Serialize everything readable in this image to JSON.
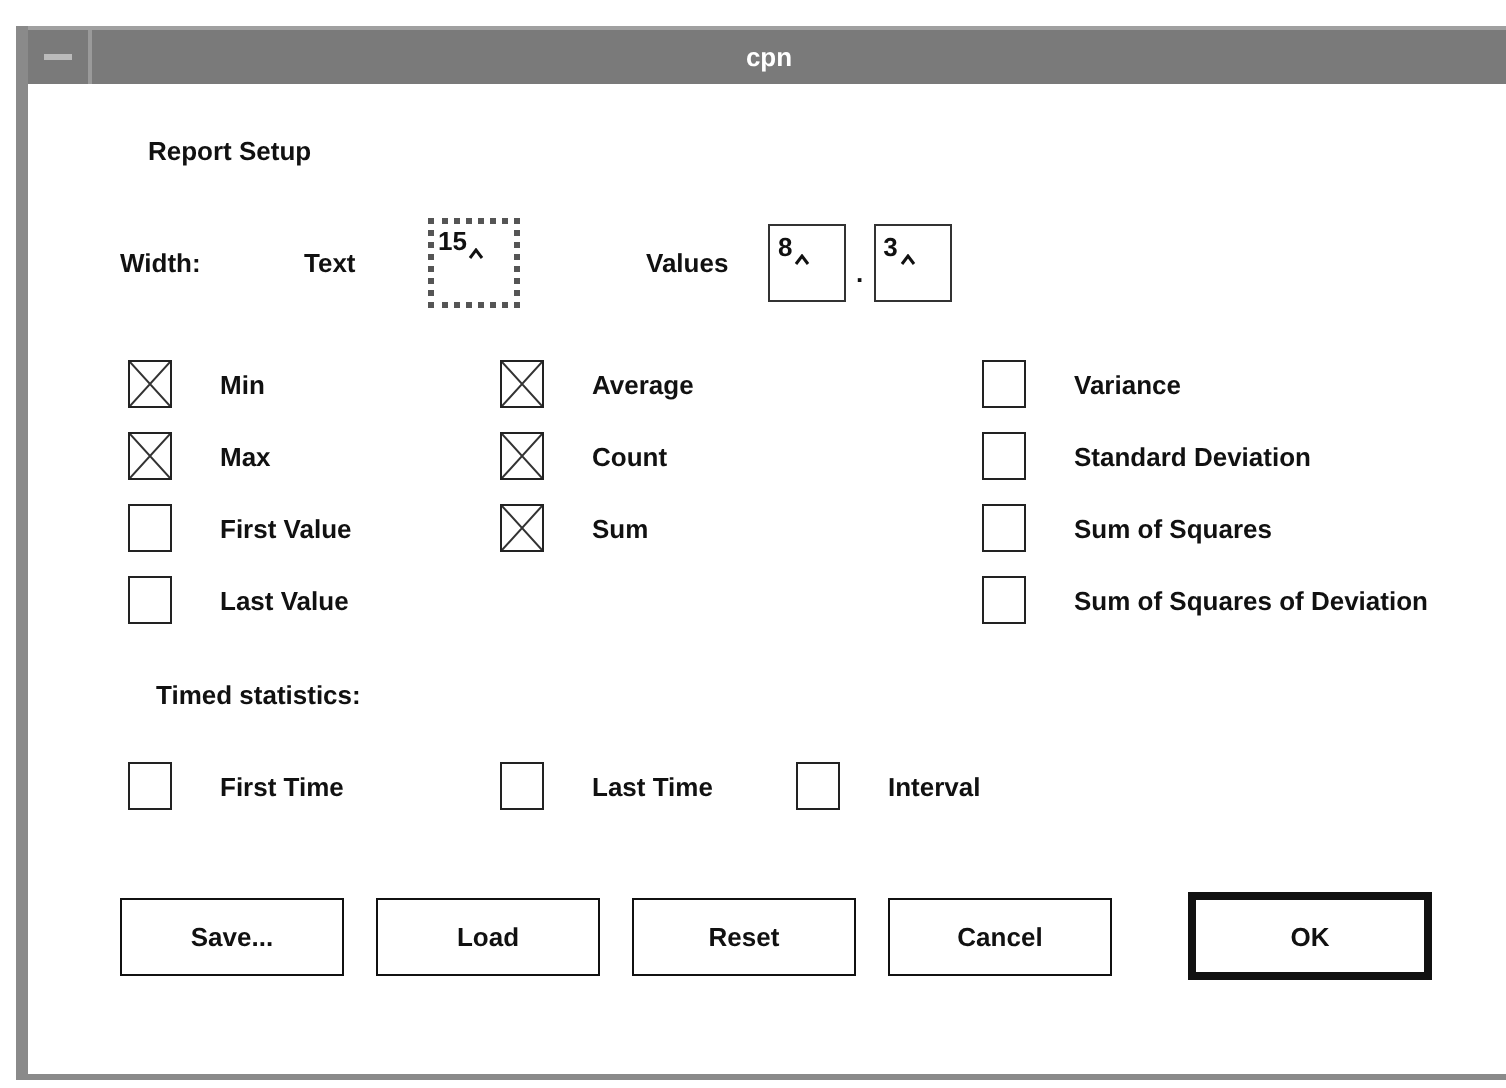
{
  "window": {
    "title": "cpn"
  },
  "heading": "Report Setup",
  "width": {
    "label": "Width:",
    "text_label": "Text",
    "text_field": {
      "value": "15",
      "focused": true
    },
    "values_label": "Values",
    "values_field": {
      "value": "8",
      "focused": false
    },
    "separator": ".",
    "decimals_field": {
      "value": "3",
      "focused": false
    }
  },
  "statistics": [
    [
      {
        "label": "Min",
        "checked": true
      },
      {
        "label": "Max",
        "checked": true
      },
      {
        "label": "First Value",
        "checked": false
      },
      {
        "label": "Last Value",
        "checked": false
      }
    ],
    [
      {
        "label": "Average",
        "checked": true
      },
      {
        "label": "Count",
        "checked": true
      },
      {
        "label": "Sum",
        "checked": true
      }
    ],
    [
      {
        "label": "Variance",
        "checked": false
      },
      {
        "label": "Standard Deviation",
        "checked": false
      },
      {
        "label": "Sum of Squares",
        "checked": false
      },
      {
        "label": "Sum of Squares of Deviation",
        "checked": false
      }
    ]
  ],
  "timed_heading": "Timed statistics:",
  "timed": [
    {
      "label": "First Time",
      "checked": false
    },
    {
      "label": "Last Time",
      "checked": false
    },
    {
      "label": "Interval",
      "checked": false
    }
  ],
  "buttons": [
    {
      "label": "Save...",
      "default": false
    },
    {
      "label": "Load",
      "default": false
    },
    {
      "label": "Reset",
      "default": false
    },
    {
      "label": "Cancel",
      "default": false
    },
    {
      "label": "OK",
      "default": true
    }
  ]
}
